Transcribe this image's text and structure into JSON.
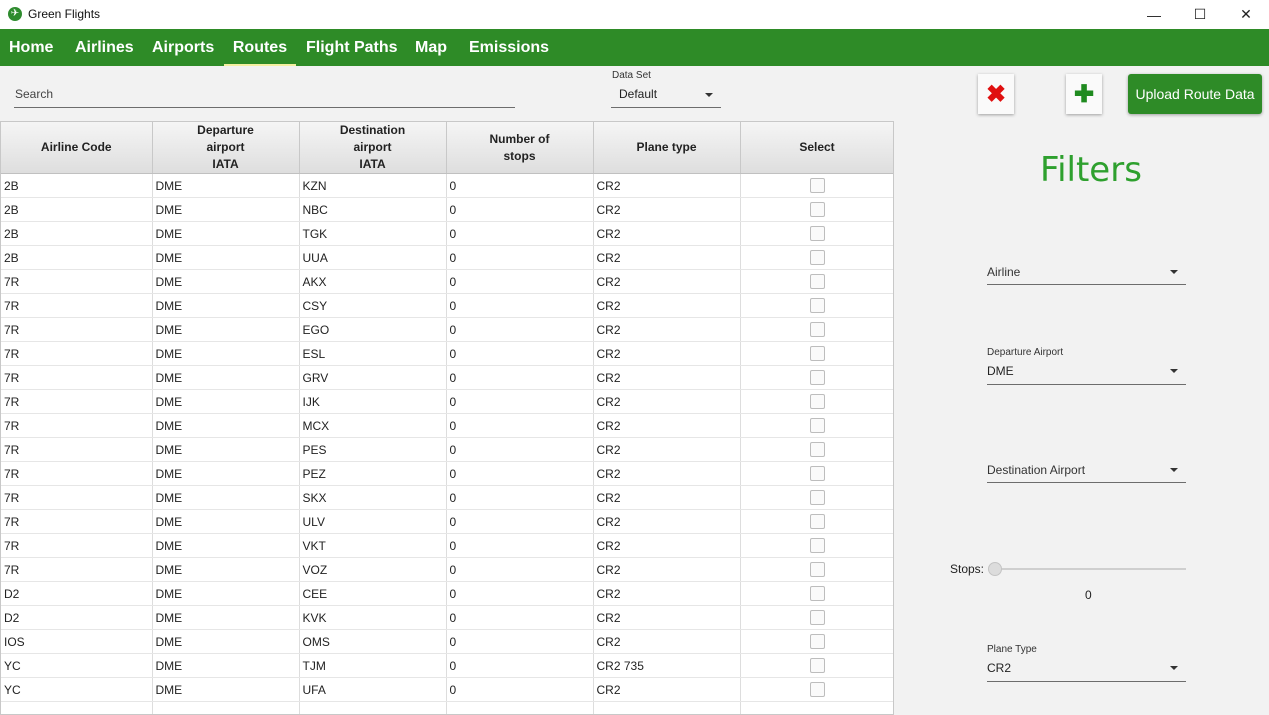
{
  "window": {
    "title": "Green Flights",
    "minimize": "—",
    "maximize": "☐",
    "close": "✕"
  },
  "nav": {
    "items": [
      {
        "label": "Home"
      },
      {
        "label": "Airlines"
      },
      {
        "label": "Airports"
      },
      {
        "label": "Routes"
      },
      {
        "label": "Flight Paths"
      },
      {
        "label": "Map"
      },
      {
        "label": "Emissions"
      }
    ],
    "active": "Routes"
  },
  "search": {
    "placeholder": "Search",
    "value": ""
  },
  "dataset": {
    "label": "Data Set",
    "value": "Default"
  },
  "table": {
    "headers": [
      "Airline Code",
      "Departure\nairport\nIATA",
      "Destination\nairport\nIATA",
      "Number of\nstops",
      "Plane type",
      "Select"
    ],
    "rows": [
      [
        "2B",
        "DME",
        "KZN",
        "0",
        "CR2"
      ],
      [
        "2B",
        "DME",
        "NBC",
        "0",
        "CR2"
      ],
      [
        "2B",
        "DME",
        "TGK",
        "0",
        "CR2"
      ],
      [
        "2B",
        "DME",
        "UUA",
        "0",
        "CR2"
      ],
      [
        "7R",
        "DME",
        "AKX",
        "0",
        "CR2"
      ],
      [
        "7R",
        "DME",
        "CSY",
        "0",
        "CR2"
      ],
      [
        "7R",
        "DME",
        "EGO",
        "0",
        "CR2"
      ],
      [
        "7R",
        "DME",
        "ESL",
        "0",
        "CR2"
      ],
      [
        "7R",
        "DME",
        "GRV",
        "0",
        "CR2"
      ],
      [
        "7R",
        "DME",
        "IJK",
        "0",
        "CR2"
      ],
      [
        "7R",
        "DME",
        "MCX",
        "0",
        "CR2"
      ],
      [
        "7R",
        "DME",
        "PES",
        "0",
        "CR2"
      ],
      [
        "7R",
        "DME",
        "PEZ",
        "0",
        "CR2"
      ],
      [
        "7R",
        "DME",
        "SKX",
        "0",
        "CR2"
      ],
      [
        "7R",
        "DME",
        "ULV",
        "0",
        "CR2"
      ],
      [
        "7R",
        "DME",
        "VKT",
        "0",
        "CR2"
      ],
      [
        "7R",
        "DME",
        "VOZ",
        "0",
        "CR2"
      ],
      [
        "D2",
        "DME",
        "CEE",
        "0",
        "CR2"
      ],
      [
        "D2",
        "DME",
        "KVK",
        "0",
        "CR2"
      ],
      [
        "IOS",
        "DME",
        "OMS",
        "0",
        "CR2"
      ],
      [
        "YC",
        "DME",
        "TJM",
        "0",
        "CR2 735"
      ],
      [
        "YC",
        "DME",
        "UFA",
        "0",
        "CR2"
      ]
    ]
  },
  "actions": {
    "delete_icon": "✖",
    "add_icon": "✚",
    "upload_label": "Upload Route Data"
  },
  "filters": {
    "title": "Filters",
    "airline": {
      "label": "",
      "value": "Airline"
    },
    "departure": {
      "label": "Departure Airport",
      "value": "DME"
    },
    "destination": {
      "label": "",
      "value": "Destination Airport"
    },
    "stops": {
      "label": "Stops:",
      "value": "0"
    },
    "plane_type": {
      "label": "Plane Type",
      "value": "CR2"
    }
  },
  "colors": {
    "accent": "#2e8b27",
    "filters_title": "#2ea02e",
    "delete": "#e01010",
    "nav_active_underline": "#f4f0a0"
  }
}
